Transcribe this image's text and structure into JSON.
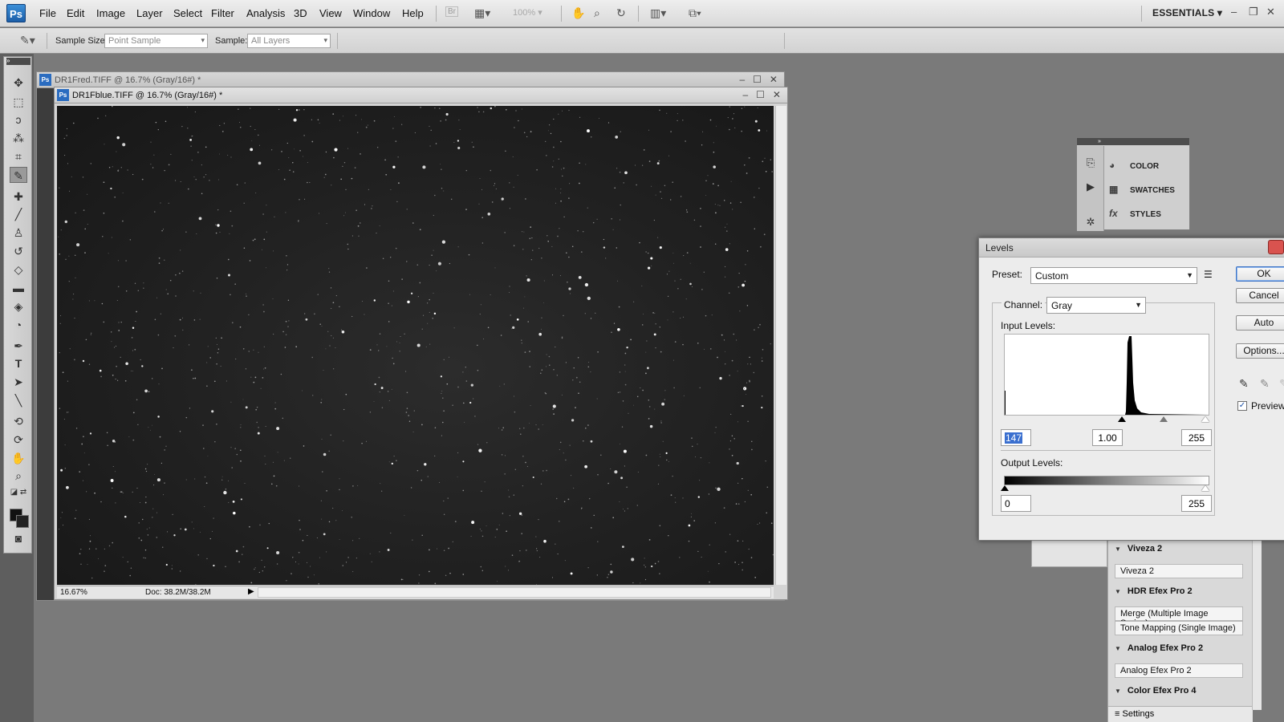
{
  "app": {
    "logo": "Ps"
  },
  "menu": [
    "File",
    "Edit",
    "Image",
    "Layer",
    "Select",
    "Filter",
    "Analysis",
    "3D",
    "View",
    "Window",
    "Help"
  ],
  "appbar": {
    "bridge": "Br",
    "zoom": "100%",
    "workspace": "ESSENTIALS"
  },
  "options": {
    "sample_size_label": "Sample Size:",
    "sample_size_value": "Point Sample",
    "sample_label": "Sample:",
    "sample_value": "All Layers"
  },
  "documents": {
    "back_title": "DR1Fred.TIFF @ 16.7% (Gray/16#) *",
    "front_title": "DR1Fblue.TIFF @ 16.7% (Gray/16#) *",
    "status_zoom": "16.67%",
    "status_doc": "Doc: 38.2M/38.2M"
  },
  "mini_panel": {
    "items": [
      "COLOR",
      "SWATCHES",
      "STYLES"
    ],
    "icons": [
      "palette-icon",
      "grid-icon",
      "fx-icon"
    ]
  },
  "nik": {
    "groups": [
      {
        "name": "Viveza 2",
        "buttons": [
          "Viveza 2"
        ]
      },
      {
        "name": "HDR Efex Pro 2",
        "buttons": [
          "Merge (Multiple Image Series)",
          "Tone Mapping (Single Image)"
        ]
      },
      {
        "name": "Analog Efex Pro 2",
        "buttons": [
          "Analog Efex Pro 2"
        ]
      },
      {
        "name": "Color Efex Pro 4",
        "buttons": []
      }
    ],
    "settings": "Settings"
  },
  "levels": {
    "title": "Levels",
    "preset_label": "Preset:",
    "preset_value": "Custom",
    "channel_label": "Channel:",
    "channel_value": "Gray",
    "input_label": "Input Levels:",
    "input_black": "147",
    "input_gamma": "1.00",
    "input_white": "255",
    "output_label": "Output Levels:",
    "output_black": "0",
    "output_white": "255",
    "buttons": {
      "ok": "OK",
      "cancel": "Cancel",
      "auto": "Auto",
      "options": "Options..."
    },
    "preview_label": "Preview",
    "preview_checked": true
  }
}
